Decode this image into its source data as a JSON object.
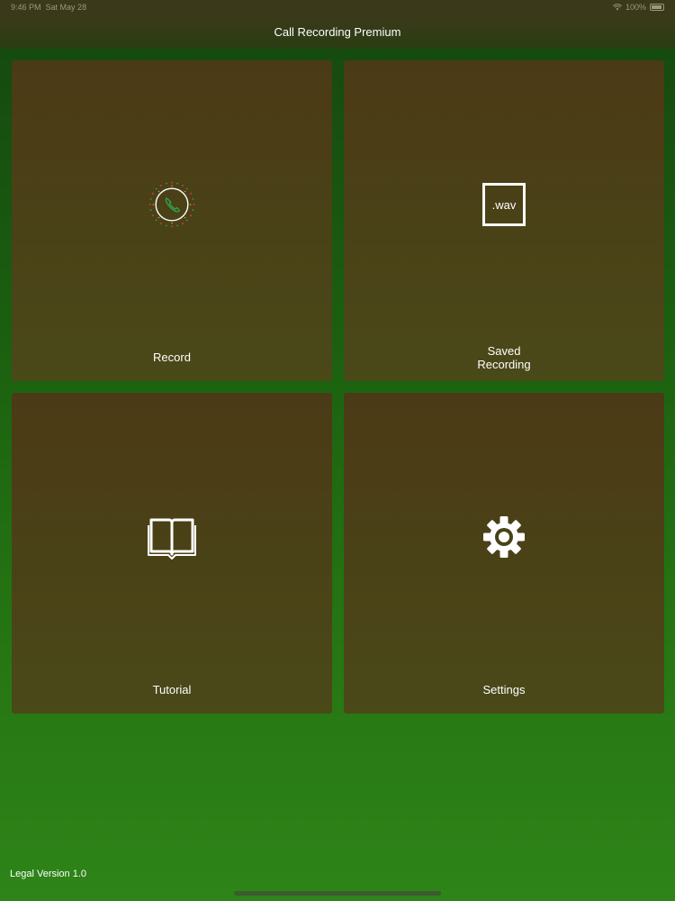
{
  "status_bar": {
    "time": "9:46 PM",
    "date": "Sat May 28",
    "battery": "100%"
  },
  "nav": {
    "title": "Call Recording Premium"
  },
  "tiles": [
    {
      "label": "Record",
      "icon": "phone-record-icon"
    },
    {
      "label": "Saved\nRecording",
      "icon": "wav-file-icon",
      "icon_text": ".wav"
    },
    {
      "label": "Tutorial",
      "icon": "book-icon"
    },
    {
      "label": "Settings",
      "icon": "gear-icon"
    }
  ],
  "footer": {
    "legal": "Legal Version 1.0"
  },
  "colors": {
    "background_top": "#15470f",
    "background_bottom": "#2e8418",
    "tile": "#4a4418",
    "phone_icon": "#2ea44a"
  }
}
